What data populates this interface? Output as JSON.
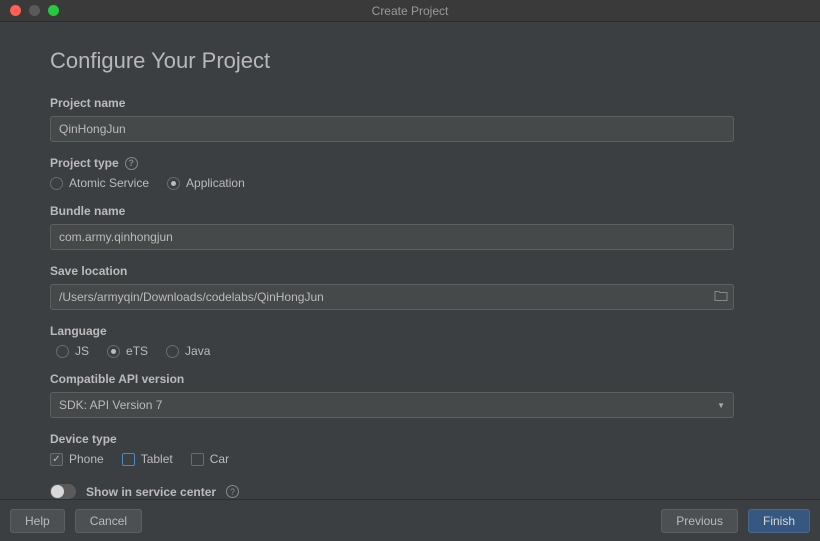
{
  "window": {
    "title": "Create Project"
  },
  "page": {
    "heading": "Configure Your Project"
  },
  "fields": {
    "project_name": {
      "label": "Project name",
      "value": "QinHongJun"
    },
    "project_type": {
      "label": "Project type",
      "options": {
        "atomic": "Atomic Service",
        "application": "Application"
      },
      "selected": "application"
    },
    "bundle_name": {
      "label": "Bundle name",
      "value": "com.army.qinhongjun"
    },
    "save_location": {
      "label": "Save location",
      "value": "/Users/armyqin/Downloads/codelabs/QinHongJun"
    },
    "language": {
      "label": "Language",
      "options": {
        "js": "JS",
        "ets": "eTS",
        "java": "Java"
      },
      "selected": "ets"
    },
    "api_version": {
      "label": "Compatible API version",
      "value": "SDK: API Version 7"
    },
    "device_type": {
      "label": "Device type",
      "options": {
        "phone": "Phone",
        "tablet": "Tablet",
        "car": "Car"
      }
    },
    "service_center": {
      "label": "Show in service center"
    }
  },
  "buttons": {
    "help": "Help",
    "cancel": "Cancel",
    "previous": "Previous",
    "finish": "Finish"
  }
}
